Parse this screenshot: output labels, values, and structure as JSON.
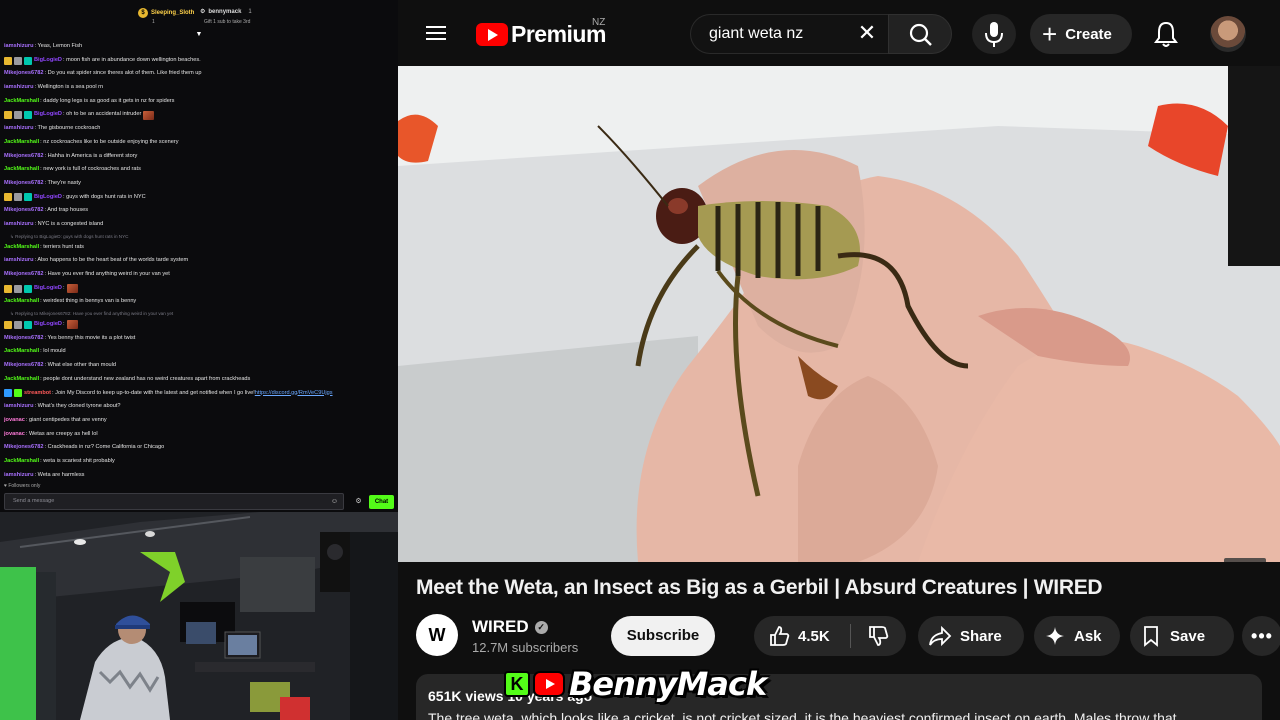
{
  "chat": {
    "top_users": [
      {
        "name": "Sleeping_Sloth",
        "count": "1"
      },
      {
        "name": "bennymack",
        "count": "1",
        "note": "Gift 1 sub to take 3rd"
      }
    ],
    "messages": [
      {
        "user": "iamshizuru",
        "color": "#a970ff",
        "text": ": Yeas, Lemon Fish"
      },
      {
        "user": "BigLogieD",
        "color": "#9147ff",
        "badges": [
          "#e8b830",
          "#9a9aa0",
          "#00c8af"
        ],
        "text": ": moon fish are in abundance down wellington beaches."
      },
      {
        "user": "Mikejones6782",
        "color": "#a970ff",
        "text": ": Do you eat spider since theres alot of them. Like fried them up"
      },
      {
        "user": "iamshizuru",
        "color": "#a970ff",
        "text": ": Wellington is a sea pool rn"
      },
      {
        "user": "JackMarshall",
        "color": "#53fc18",
        "text": ": daddy long legs is as good as it gets in nz for spiders"
      },
      {
        "user": "BigLogieD",
        "color": "#9147ff",
        "badges": [
          "#e8b830",
          "#9a9aa0",
          "#00c8af"
        ],
        "text": ": oh to be an accidental intruder",
        "emote": true
      },
      {
        "user": "iamshizuru",
        "color": "#a970ff",
        "text": ": The gisbourne cockroach"
      },
      {
        "user": "JackMarshall",
        "color": "#53fc18",
        "text": ": nz cockroaches like to be outside enjoying the scenery"
      },
      {
        "user": "Mikejones6782",
        "color": "#a970ff",
        "text": ": Hahha in America is a different story"
      },
      {
        "user": "JackMarshall",
        "color": "#53fc18",
        "text": ": new york is full of cockroaches and rats"
      },
      {
        "user": "Mikejones6782",
        "color": "#a970ff",
        "text": ": They're nasty"
      },
      {
        "user": "BigLogieD",
        "color": "#9147ff",
        "badges": [
          "#e8b830",
          "#9a9aa0",
          "#00c8af"
        ],
        "text": ": guys with dogs hunt rats in NYC"
      },
      {
        "user": "Mikejones6782",
        "color": "#a970ff",
        "text": ": And trap houses"
      },
      {
        "user": "iamshizuru",
        "color": "#a970ff",
        "text": ": NYC is a congested island"
      },
      {
        "reply": "↳ Replying to BigLogieD: guys with dogs hunt rats in NYC"
      },
      {
        "user": "JackMarshall",
        "color": "#53fc18",
        "text": ": terriers hunt rats"
      },
      {
        "user": "iamshizuru",
        "color": "#a970ff",
        "text": ": Also happens to be the heart beat of the worlds tarde system"
      },
      {
        "user": "Mikejones6782",
        "color": "#a970ff",
        "text": ": Have you ever find anything weird in your van yet"
      },
      {
        "user": "BigLogieD",
        "color": "#9147ff",
        "badges": [
          "#e8b830",
          "#9a9aa0",
          "#00c8af"
        ],
        "text": ":",
        "emote": true
      },
      {
        "user": "JackMarshall",
        "color": "#53fc18",
        "text": ": weirdest thing in bennys van is benny"
      },
      {
        "reply": "↳ Replying to Mikejones6782: Have you ever find anything weird in your van yet"
      },
      {
        "user": "BigLogieD",
        "color": "#9147ff",
        "badges": [
          "#e8b830",
          "#9a9aa0",
          "#00c8af"
        ],
        "text": ":",
        "emote": true
      },
      {
        "user": "Mikejones6782",
        "color": "#a970ff",
        "text": ": Yes benny this movie its a plot twist"
      },
      {
        "user": "JackMarshall",
        "color": "#53fc18",
        "text": ": lol mould"
      },
      {
        "user": "Mikejones6782",
        "color": "#a970ff",
        "text": ": What else other than mould"
      },
      {
        "user": "JackMarshall",
        "color": "#53fc18",
        "text": ": people dont understand new zealand has no weird creatures apart from crackheads"
      },
      {
        "user": "streambot",
        "color": "#ff5a5a",
        "badges": [
          "#2f9bff",
          "#53fc18"
        ],
        "text": ": Join My Discord to keep up-to-date with the latest and get notified when I go live! ",
        "link": "https://discord.gg/RmVeC9Ujgs"
      },
      {
        "user": "iamshizuru",
        "color": "#a970ff",
        "text": ": What's they cloned tyrone about?"
      },
      {
        "user": "jovanac",
        "color": "#ff7ad9",
        "text": ": giant centipedes that are venny"
      },
      {
        "user": "jovanac",
        "color": "#ff7ad9",
        "text": ": Wetas are creepy as hell lol"
      },
      {
        "user": "Mikejones6782",
        "color": "#a970ff",
        "text": ": Crackheads in nz? Come California or Chicago"
      },
      {
        "user": "JackMarshall",
        "color": "#53fc18",
        "text": ": weta is scariest shit probably"
      },
      {
        "user": "iamshizuru",
        "color": "#a970ff",
        "text": ": Weta are harmless"
      }
    ],
    "followers_only": "♥ Followers only",
    "input_placeholder": "Send a message",
    "chat_button": "Chat"
  },
  "youtube": {
    "logo_text": "Premium",
    "region": "NZ",
    "search_query": "giant weta nz",
    "create_label": "Create",
    "video_watermark": "W",
    "title": "Meet the Weta, an Insect as Big as a Gerbil | Absurd Creatures | WIRED",
    "channel": {
      "avatar_text": "W",
      "name": "WIRED",
      "subscribers": "12.7M subscribers"
    },
    "subscribe_label": "Subscribe",
    "likes": "4.5K",
    "share_label": "Share",
    "ask_label": "Ask",
    "save_label": "Save",
    "description": {
      "stats": "651K views  10 years ago",
      "text": "The tree weta, which looks like a cricket, is not cricket sized, it is the heaviest confirmed insect on earth. Males throw that"
    }
  },
  "overlay": {
    "kick_letter": "K",
    "name": "BennyMack"
  }
}
